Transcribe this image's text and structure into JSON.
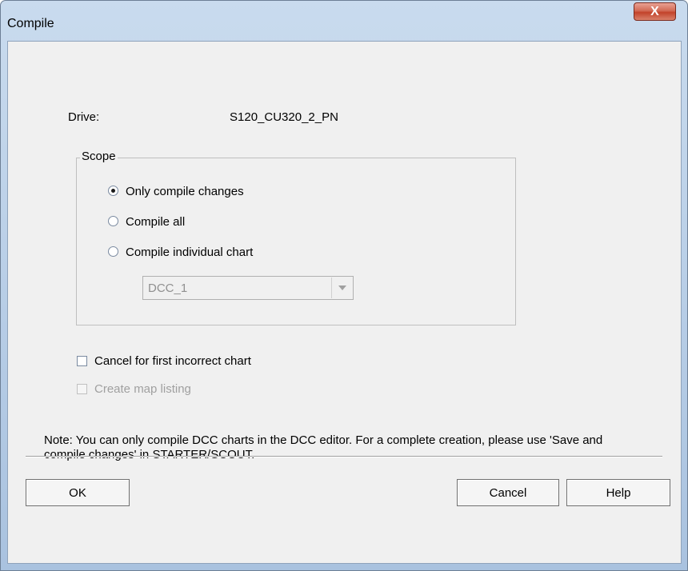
{
  "window": {
    "title": "Compile",
    "close_label": "X"
  },
  "drive": {
    "label": "Drive:",
    "value": "S120_CU320_2_PN"
  },
  "scope": {
    "legend": "Scope",
    "options": [
      {
        "label": "Only compile changes",
        "checked": true
      },
      {
        "label": "Compile all",
        "checked": false
      },
      {
        "label": "Compile individual chart",
        "checked": false
      }
    ],
    "chart_select": {
      "value": "DCC_1",
      "disabled": true
    }
  },
  "options": {
    "cancel_first_incorrect": {
      "label": "Cancel for first incorrect chart",
      "checked": false
    },
    "create_map_listing": {
      "label": "Create map listing",
      "checked": false,
      "disabled": true
    }
  },
  "note": "Note: You can only compile DCC charts in the DCC editor. For a complete creation, please use 'Save and compile changes' in STARTER/SCOUT.",
  "buttons": {
    "ok": "OK",
    "cancel": "Cancel",
    "help": "Help"
  }
}
